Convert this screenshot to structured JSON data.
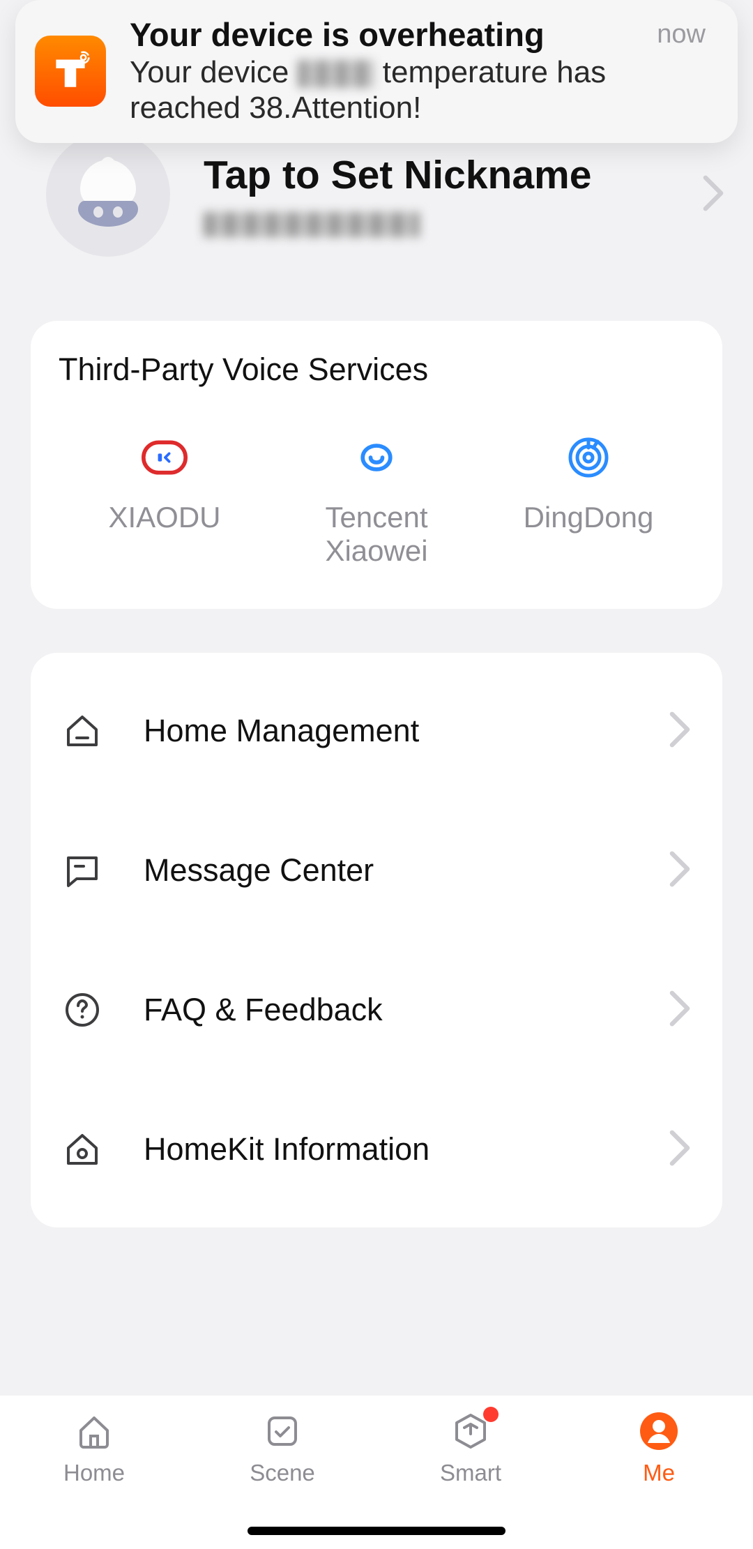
{
  "notification": {
    "title": "Your device is overheating",
    "body_prefix": "Your device ",
    "body_suffix": " temperature has reached 38.Attention!",
    "time": "now",
    "app_icon": "tuya-icon"
  },
  "profile": {
    "title": "Tap to Set Nickname"
  },
  "voice": {
    "title": "Third-Party Voice Services",
    "items": [
      {
        "icon": "xiaodu-icon",
        "label": "XIAODU"
      },
      {
        "icon": "tencent-xiaowei-icon",
        "label": "Tencent\nXiaowei"
      },
      {
        "icon": "dingdong-icon",
        "label": "DingDong"
      }
    ]
  },
  "menu": [
    {
      "icon": "home-manage-icon",
      "label": "Home Management"
    },
    {
      "icon": "message-center-icon",
      "label": "Message Center"
    },
    {
      "icon": "faq-icon",
      "label": "FAQ & Feedback"
    },
    {
      "icon": "homekit-icon",
      "label": "HomeKit Information"
    }
  ],
  "tabs": [
    {
      "icon": "home-tab-icon",
      "label": "Home",
      "active": false,
      "badge": false
    },
    {
      "icon": "scene-tab-icon",
      "label": "Scene",
      "active": false,
      "badge": false
    },
    {
      "icon": "smart-tab-icon",
      "label": "Smart",
      "active": false,
      "badge": true
    },
    {
      "icon": "me-tab-icon",
      "label": "Me",
      "active": true,
      "badge": false
    }
  ]
}
